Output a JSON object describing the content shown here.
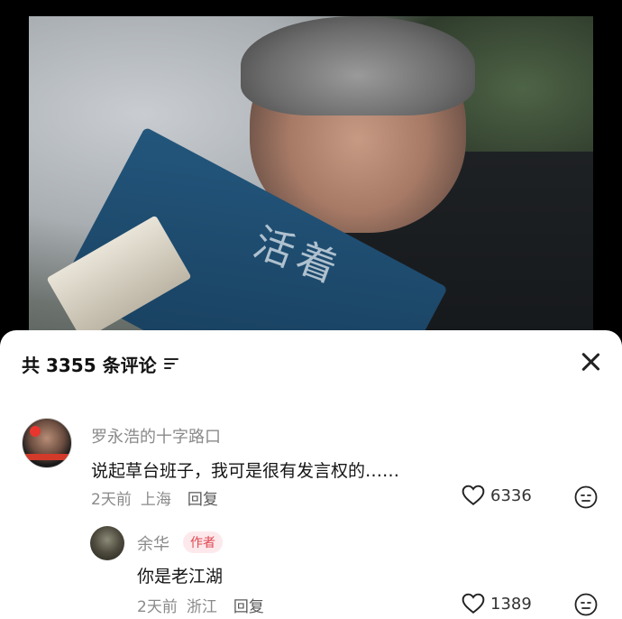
{
  "comments_header": {
    "count_label": "共 3355 条评论"
  },
  "comments": [
    {
      "nickname": "罗永浩的十字路口",
      "text": "说起草台班子，我可是很有发言权的……",
      "time": "2天前",
      "location": "上海",
      "reply_label": "回复",
      "likes": "6336"
    }
  ],
  "reply": {
    "nickname": "余华",
    "tag": "作者",
    "text": "你是老江湖",
    "time": "2天前",
    "location": "浙江",
    "reply_label": "回复",
    "likes": "1389"
  },
  "video": {
    "book_title": "活着"
  },
  "colors": {
    "author_tag": "#e0464f",
    "sheet_bg": "#ffffff"
  },
  "icons": [
    "filter-icon",
    "close-icon",
    "heart-icon",
    "dislike-face-icon"
  ]
}
